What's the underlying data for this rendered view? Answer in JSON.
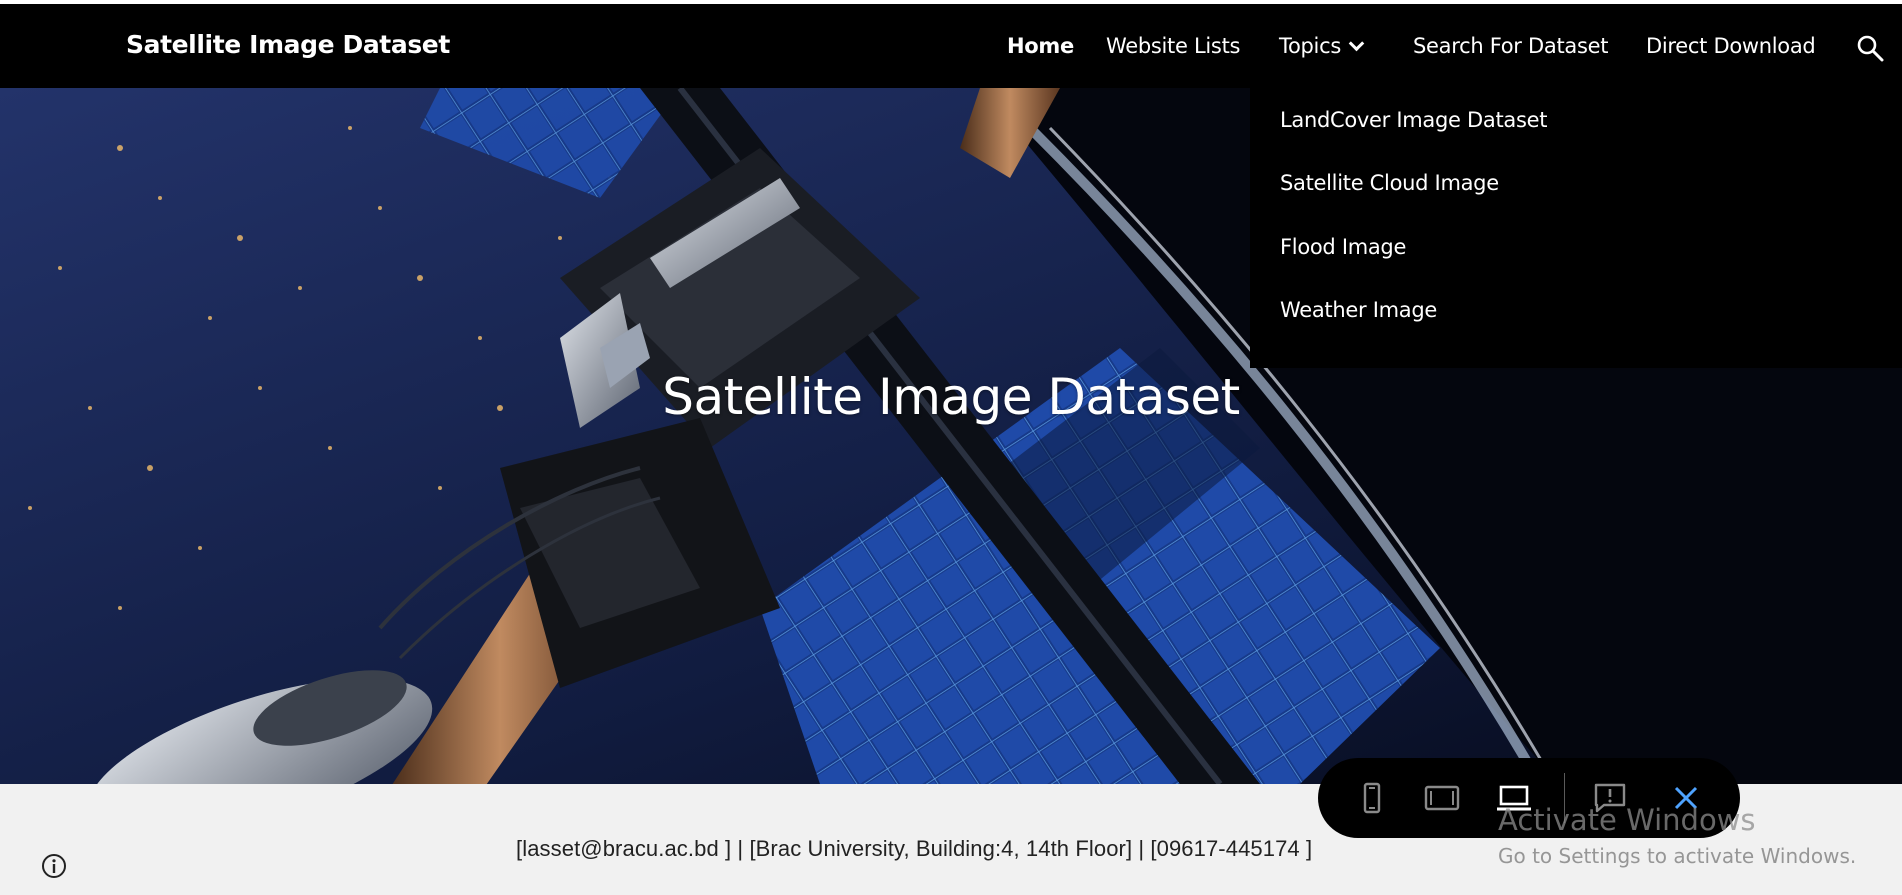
{
  "header": {
    "site_title": "Satellite Image Dataset",
    "nav": [
      {
        "label": "Home",
        "active": true
      },
      {
        "label": "Website Lists",
        "active": false
      },
      {
        "label": "Topics",
        "active": false,
        "has_dropdown": true
      },
      {
        "label": "Search For Dataset",
        "active": false
      },
      {
        "label": "Direct Download",
        "active": false
      }
    ],
    "search_icon": "search-icon"
  },
  "dropdown": {
    "items": [
      {
        "label": "LandCover Image Dataset"
      },
      {
        "label": "Satellite Cloud Image"
      },
      {
        "label": "Flood Image"
      },
      {
        "label": "Weather Image"
      }
    ]
  },
  "hero": {
    "title": "Satellite Image Dataset"
  },
  "footer": {
    "info": "[lasset@bracu.ac.bd ]  |  [Brac University, Building:4, 14th Floor]  |  [09617-445174 ]"
  },
  "preview_toolbar": {
    "buttons": [
      "phone-icon",
      "tablet-icon",
      "laptop-icon",
      "feedback-icon",
      "close-icon"
    ],
    "accent": "#4ea3ff"
  },
  "watermark": {
    "title": "Activate Windows",
    "subtitle": "Go to Settings to activate Windows."
  }
}
